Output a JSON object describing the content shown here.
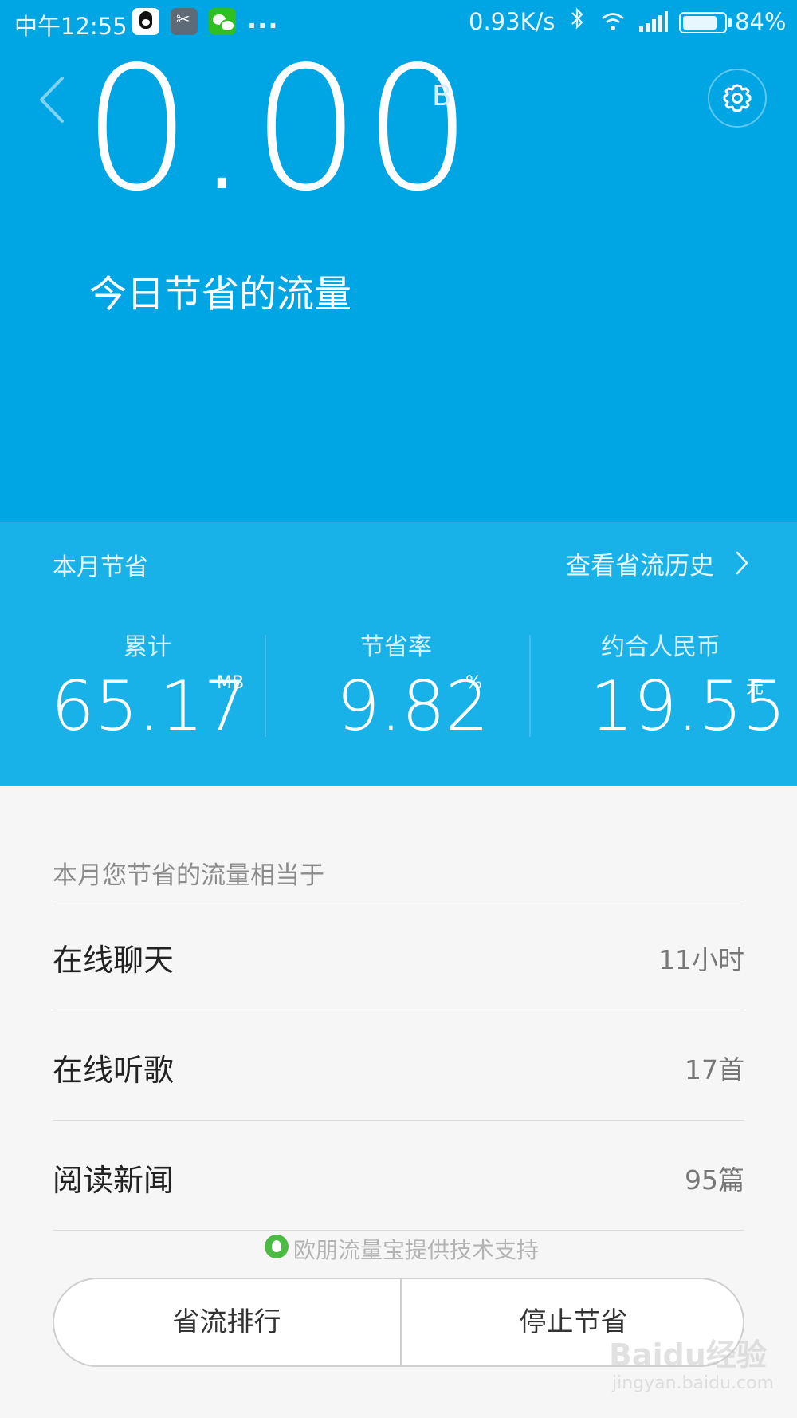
{
  "status_bar": {
    "time": "中午12:55",
    "more": "...",
    "net_speed": "0.93K/s",
    "battery_percent_text": "84%",
    "battery_level": 0.84,
    "notification_icons": [
      "qq-icon",
      "app-icon",
      "wechat-icon"
    ]
  },
  "header": {
    "saved_today_value": "0.00",
    "saved_today_unit": "B",
    "saved_today_label": "今日节省的流量"
  },
  "month": {
    "label": "本月节省",
    "history_link": "查看省流历史",
    "stats": [
      {
        "label": "累计",
        "value": "65.17",
        "unit": "MB"
      },
      {
        "label": "节省率",
        "value": "9.82",
        "unit": "%"
      },
      {
        "label": "约合人民币",
        "value": "19.55",
        "unit": "元"
      }
    ]
  },
  "equivalent": {
    "title": "本月您节省的流量相当于",
    "items": [
      {
        "label": "在线聊天",
        "value": "11小时"
      },
      {
        "label": "在线听歌",
        "value": "17首"
      },
      {
        "label": "阅读新闻",
        "value": "95篇"
      }
    ]
  },
  "tech_support": "欧朋流量宝提供技术支持",
  "buttons": {
    "ranking": "省流排行",
    "stop": "停止节省"
  },
  "watermark": {
    "main": "Baidu经验",
    "sub": "jingyan.baidu.com"
  },
  "colors": {
    "header_bg": "#00a5e4",
    "stats_bg": "#19b2e8",
    "list_bg": "#f6f6f6"
  }
}
